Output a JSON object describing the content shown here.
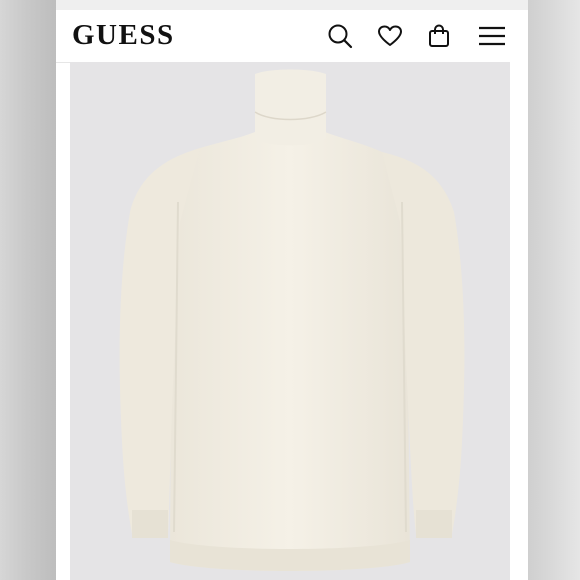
{
  "brand": {
    "logo_text": "GUESS"
  },
  "header_icons": [
    "search-icon",
    "heart-icon",
    "shopping-bag-icon",
    "hamburger-menu-icon"
  ],
  "product": {
    "image": "cream-turtleneck-sweater",
    "color_name": "cream",
    "sweater_color": "#f4f0e6",
    "background_color": "#e5e4e6"
  }
}
